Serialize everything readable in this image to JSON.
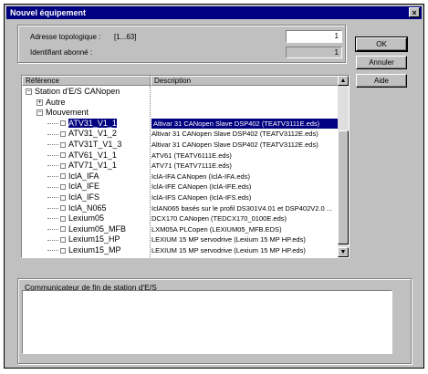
{
  "window": {
    "title": "Nouvel équipement",
    "close_glyph": "×"
  },
  "topology": {
    "address_label": "Adresse topologique :",
    "address_range": "[1...63]",
    "address_value": "1",
    "subscriber_label": "Identifiant abonné :",
    "subscriber_value": "1"
  },
  "buttons": {
    "ok": "OK",
    "cancel": "Annuler",
    "help": "Aide"
  },
  "table": {
    "col_reference": "Référence",
    "col_description": "Description",
    "rows": [
      {
        "ref": "Station d'E/S CANopen",
        "desc": "",
        "level": 0,
        "expander": "−"
      },
      {
        "ref": "Autre",
        "desc": "",
        "level": 1,
        "expander": "+"
      },
      {
        "ref": "Mouvement",
        "desc": "",
        "level": 1,
        "expander": "−"
      },
      {
        "ref": "ATV31_V1_1",
        "desc": "Altivar 31 CANopen Slave DSP402 (TEATV3111E.eds)",
        "level": 2,
        "selected": true
      },
      {
        "ref": "ATV31_V1_2",
        "desc": "Altivar 31 CANopen Slave DSP402 (TEATV3112E.eds)",
        "level": 2
      },
      {
        "ref": "ATV31T_V1_3",
        "desc": "Altivar 31 CANopen Slave DSP402 (TEATV3112E.eds)",
        "level": 2
      },
      {
        "ref": "ATV61_V1_1",
        "desc": "ATV61 (TEATV6111E.eds)",
        "level": 2
      },
      {
        "ref": "ATV71_V1_1",
        "desc": "ATV71 (TEATV7111E.eds)",
        "level": 2
      },
      {
        "ref": "IclA_IFA",
        "desc": "IclA-IFA CANopen (IclA-IFA.eds)",
        "level": 2
      },
      {
        "ref": "IclA_IFE",
        "desc": "IclA-IFE CANopen (IclA-IFE.eds)",
        "level": 2
      },
      {
        "ref": "IclA_IFS",
        "desc": "IclA-IFS CANopen (IclA-IFS.eds)",
        "level": 2
      },
      {
        "ref": "IclA_N065",
        "desc": "IclAN065 basés sur le profil DS301V4.01 et DSP402V2.0 ...",
        "level": 2
      },
      {
        "ref": "Lexium05",
        "desc": "DCX170 CANopen (TEDCX170_0100E.eds)",
        "level": 2
      },
      {
        "ref": "Lexium05_MFB",
        "desc": "LXM05A PLCopen (LEXIUM05_MFB.EDS)",
        "level": 2
      },
      {
        "ref": "Lexium15_HP",
        "desc": "LEXIUM 15 MP servodrive (Lexium 15 MP HP.eds)",
        "level": 2
      },
      {
        "ref": "Lexium15_MP",
        "desc": "LEXIUM 15 MP servodrive (Lexium 15 MP HP.eds)",
        "level": 2
      }
    ]
  },
  "scrollbar": {
    "up": "▲",
    "down": "▼"
  },
  "communicator": {
    "label": "Communicateur de fin de station d'E/S",
    "value": ""
  }
}
